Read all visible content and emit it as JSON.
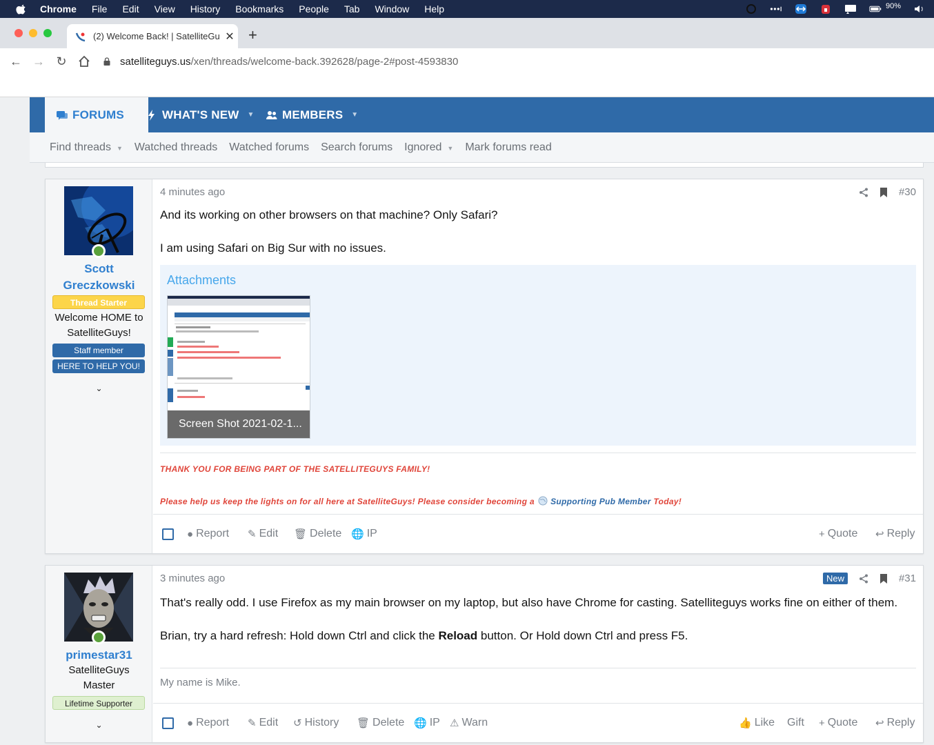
{
  "os_menubar": {
    "app_name": "Chrome",
    "items": [
      "File",
      "Edit",
      "View",
      "History",
      "Bookmarks",
      "People",
      "Tab",
      "Window",
      "Help"
    ],
    "battery": "90%"
  },
  "browser": {
    "tab_title": "(2) Welcome Back! | SatelliteGu",
    "url_host": "satelliteguys.us",
    "url_path": "/xen/threads/welcome-back.392628/page-2#post-4593830"
  },
  "site": {
    "nav_tabs": [
      "FORUMS",
      "WHAT'S NEW",
      "MEMBERS"
    ],
    "sub_nav": [
      "Find threads",
      "Watched threads",
      "Watched forums",
      "Search forums",
      "Ignored",
      "Mark forums read"
    ]
  },
  "posts": [
    {
      "user": {
        "name_line1": "Scott",
        "name_line2": "Greczkowski",
        "banner": "Thread Starter",
        "title_line1": "Welcome HOME to",
        "title_line2": "SatelliteGuys!",
        "badge1": "Staff member",
        "badge2": "HERE TO HELP YOU!"
      },
      "time": "4 minutes ago",
      "number": "#30",
      "message_line1": "And its working on other browsers on that machine? Only Safari?",
      "message_line2": "I am using Safari on Big Sur with no issues.",
      "attachments_heading": "Attachments",
      "attachment_caption": "Screen Shot 2021-02-1...",
      "signature_line1": "THANK YOU FOR BEING PART OF THE SATELLITEGUYS FAMILY!",
      "signature_line2_start": "Please help us keep the lights on for all here at SatelliteGuys! Please consider becoming a",
      "signature_line2_link": "Supporting Pub Member",
      "signature_line2_end": "Today!",
      "actions": {
        "report": "Report",
        "edit": "Edit",
        "delete": "Delete",
        "ip": "IP",
        "quote": "Quote",
        "reply": "Reply"
      }
    },
    {
      "user": {
        "name": "primestar31",
        "title_line1": "SatelliteGuys",
        "title_line2": "Master",
        "badge": "Lifetime Supporter"
      },
      "time": "3 minutes ago",
      "new_label": "New",
      "number": "#31",
      "message_line1": "That's really odd. I use Firefox as my main browser on my laptop, but also have Chrome for casting. Satelliteguys works fine on either of them.",
      "message_line2_start": "Brian, try a hard refresh: Hold down Ctrl and click the",
      "message_line2_bold": "Reload",
      "message_line2_end": "button. Or Hold down Ctrl and press F5.",
      "signature": "My name is Mike.",
      "actions": {
        "report": "Report",
        "edit": "Edit",
        "history": "History",
        "delete": "Delete",
        "ip": "IP",
        "warn": "Warn",
        "like": "Like",
        "gift": "Gift",
        "quote": "Quote",
        "reply": "Reply"
      }
    }
  ]
}
